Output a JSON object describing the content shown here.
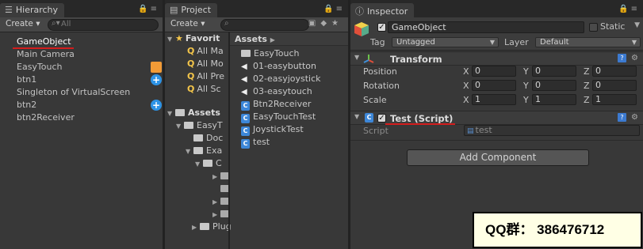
{
  "hierarchy": {
    "tab": "Hierarchy",
    "create": "Create",
    "search_placeholder": "All",
    "items": [
      "GameObject",
      "Main Camera",
      "EasyTouch",
      "btn1",
      "Singleton of VirtualScreen",
      "btn2",
      "btn2Receiver"
    ]
  },
  "project": {
    "tab": "Project",
    "create": "Create",
    "left": {
      "favorites": "Favorit",
      "fav_items": [
        "All Ma",
        "All Mo",
        "All Pre",
        "All Sc"
      ],
      "assets": "Assets",
      "tree": [
        "EasyT",
        "Doc",
        "Exa",
        "C",
        "",
        "",
        "",
        "Plug"
      ]
    },
    "right": {
      "header": "Assets",
      "items": [
        "EasyTouch",
        "01-easybutton",
        "02-easyjoystick",
        "03-easytouch",
        "Btn2Receiver",
        "EasyTouchTest",
        "JoystickTest",
        "test"
      ]
    }
  },
  "inspector": {
    "tab": "Inspector",
    "object_name": "GameObject",
    "static_label": "Static",
    "tag_label": "Tag",
    "tag_value": "Untagged",
    "layer_label": "Layer",
    "layer_value": "Default",
    "transform": {
      "title": "Transform",
      "position": {
        "label": "Position",
        "x": "0",
        "y": "0",
        "z": "0"
      },
      "rotation": {
        "label": "Rotation",
        "x": "0",
        "y": "0",
        "z": "0"
      },
      "scale": {
        "label": "Scale",
        "x": "1",
        "y": "1",
        "z": "1"
      }
    },
    "script_component": {
      "title": "Test (Script)",
      "script_label": "Script",
      "script_value": "test"
    },
    "add_component": "Add Component"
  },
  "axis_labels": {
    "x": "X",
    "y": "Y",
    "z": "Z"
  },
  "watermark": "QQ群： 386476712"
}
